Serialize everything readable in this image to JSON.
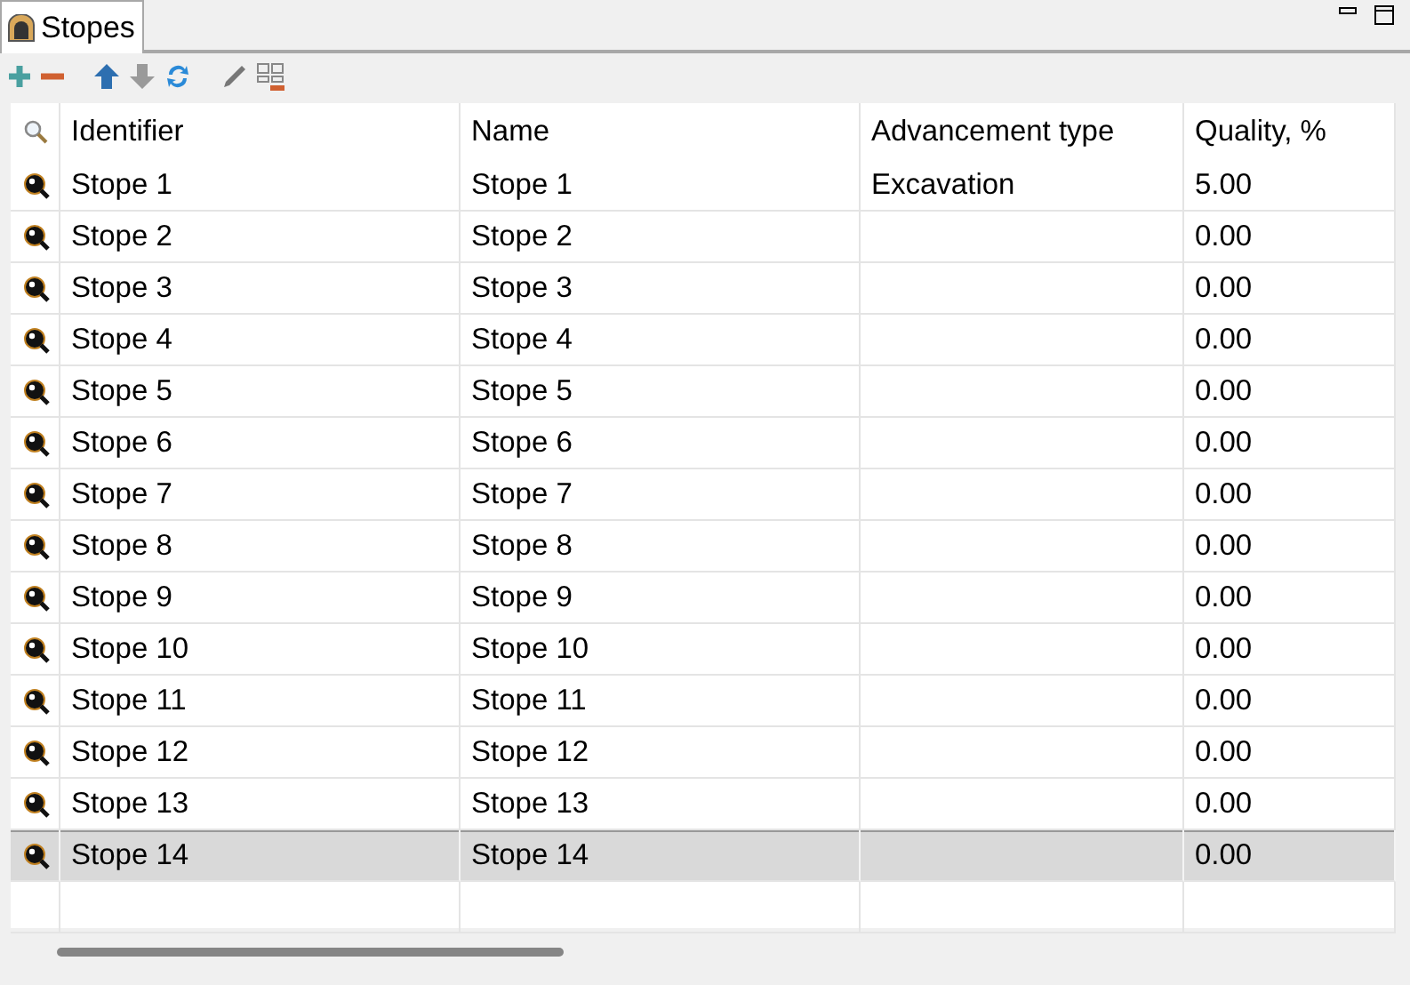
{
  "tab": {
    "title": "Stopes",
    "selected": true
  },
  "table": {
    "columns": [
      "Identifier",
      "Name",
      "Advancement type",
      "Quality, %"
    ],
    "rows": [
      {
        "identifier": "Stope 1",
        "name": "Stope 1",
        "advancement_type": "Excavation",
        "quality": "5.00",
        "selected": false
      },
      {
        "identifier": "Stope 2",
        "name": "Stope 2",
        "quality": "0.00",
        "selected": false
      },
      {
        "identifier": "Stope 3",
        "name": "Stope 3",
        "quality": "0.00",
        "selected": false
      },
      {
        "identifier": "Stope 4",
        "name": "Stope 4",
        "quality": "0.00",
        "selected": false
      },
      {
        "identifier": "Stope 5",
        "name": "Stope 5",
        "quality": "0.00",
        "selected": false
      },
      {
        "identifier": "Stope 6",
        "name": "Stope 6",
        "quality": "0.00",
        "selected": false
      },
      {
        "identifier": "Stope 7",
        "name": "Stope 7",
        "quality": "0.00",
        "selected": false
      },
      {
        "identifier": "Stope 8",
        "name": "Stope 8",
        "quality": "0.00",
        "selected": false
      },
      {
        "identifier": "Stope 9",
        "name": "Stope 9",
        "quality": "0.00",
        "selected": false
      },
      {
        "identifier": "Stope 10",
        "name": "Stope 10",
        "quality": "0.00",
        "selected": false
      },
      {
        "identifier": "Stope 11",
        "name": "Stope 11",
        "quality": "0.00",
        "selected": false
      },
      {
        "identifier": "Stope 12",
        "name": "Stope 12",
        "quality": "0.00",
        "selected": false
      },
      {
        "identifier": "Stope 13",
        "name": "Stope 13",
        "quality": "0.00",
        "selected": false
      },
      {
        "identifier": "Stope 14",
        "name": "Stope 14",
        "quality": "0.00",
        "selected": true
      }
    ]
  }
}
